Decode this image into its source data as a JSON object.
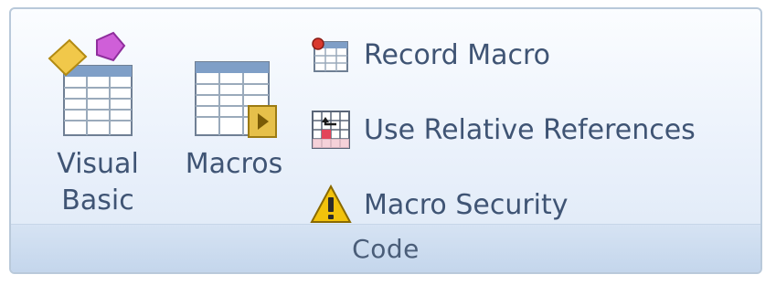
{
  "group": {
    "label": "Code"
  },
  "buttons": {
    "visual_basic": {
      "label_line1": "Visual",
      "label_line2": "Basic",
      "icon": "visual-basic-icon"
    },
    "macros": {
      "label": "Macros",
      "icon": "macros-icon"
    },
    "record_macro": {
      "label": "Record Macro",
      "icon": "record-macro-icon"
    },
    "relative_refs": {
      "label": "Use Relative References",
      "icon": "relative-references-icon"
    },
    "macro_security": {
      "label": "Macro Security",
      "icon": "warning-icon"
    }
  },
  "colors": {
    "text": "#3f5474",
    "group_label": "#4a5d78",
    "warning": "#f2c20c",
    "border": "#b9c9da"
  }
}
